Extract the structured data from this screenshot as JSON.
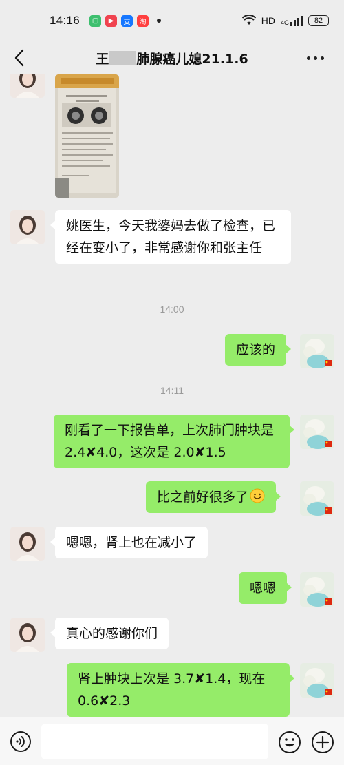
{
  "status_bar": {
    "time": "14:16",
    "network": "HD",
    "signal_label": "4G",
    "battery": "82",
    "app_icons": [
      {
        "name": "messages-app-icon",
        "color": "#3dbf6e"
      },
      {
        "name": "video-app-icon",
        "color": "#f0434f"
      },
      {
        "name": "alipay-app-icon",
        "color": "#1677ff"
      },
      {
        "name": "taobao-app-icon",
        "color": "#ff3f3f"
      }
    ]
  },
  "header": {
    "title_prefix": "王",
    "title_suffix": "肺腺癌儿媳21.1.6",
    "back_icon": "chevron-left-icon",
    "menu_icon": "more-icon"
  },
  "messages": [
    {
      "side": "left",
      "type": "image",
      "description_icon": "report-photo"
    },
    {
      "side": "left",
      "type": "text",
      "text": "姚医生，今天我婆妈去做了检查，已经在变小了，非常感谢你和张主任"
    },
    {
      "type": "time",
      "text": "14:00"
    },
    {
      "side": "right",
      "type": "text",
      "text": "应该的"
    },
    {
      "type": "time",
      "text": "14:11"
    },
    {
      "side": "right",
      "type": "text",
      "text": "刚看了一下报告单，上次肺门肿块是 2.4✘4.0，这次是 2.0✘1.5"
    },
    {
      "side": "right",
      "type": "text",
      "text": "比之前好很多了",
      "emoji": "smile-emoji-icon"
    },
    {
      "side": "left",
      "type": "text",
      "text": "嗯嗯，肾上也在减小了"
    },
    {
      "side": "right",
      "type": "text",
      "text": "嗯嗯"
    },
    {
      "side": "left",
      "type": "text",
      "text": "真心的感谢你们"
    },
    {
      "side": "right",
      "type": "text",
      "text": "肾上肿块上次是 3.7✘1.4，现在 0.6✘2.3"
    }
  ],
  "input_bar": {
    "placeholder": "",
    "voice_icon": "voice-icon",
    "emoji_icon": "emoji-icon",
    "plus_icon": "plus-icon"
  },
  "colors": {
    "background": "#ededed",
    "sent_bubble": "#95ec69",
    "received_bubble": "#ffffff"
  }
}
